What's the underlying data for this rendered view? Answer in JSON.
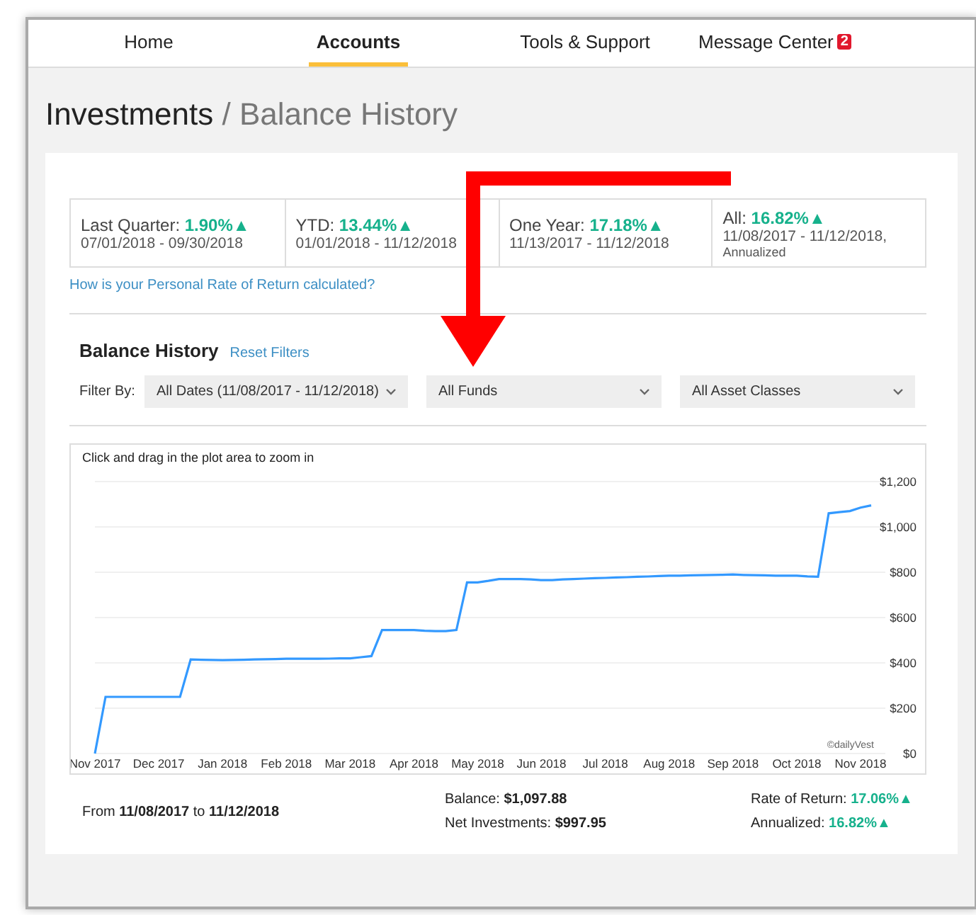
{
  "nav": {
    "tabs": [
      {
        "label": "Home",
        "selected": false
      },
      {
        "label": "Accounts",
        "selected": true
      },
      {
        "label": "Tools & Support",
        "selected": false
      },
      {
        "label": "Message Center",
        "selected": false,
        "badge": "2"
      }
    ]
  },
  "page_title": {
    "section": "Investments",
    "separator": "/",
    "current": "Balance History"
  },
  "returns": [
    {
      "label": "Last Quarter:",
      "value": "1.90%▲",
      "dates": "07/01/2018 - 09/30/2018"
    },
    {
      "label": "YTD:",
      "value": "13.44%▲",
      "dates": "01/01/2018 - 11/12/2018"
    },
    {
      "label": "One Year:",
      "value": "17.18%▲",
      "dates": "11/13/2017 - 11/12/2018"
    },
    {
      "label": "All:",
      "value": "16.82%▲",
      "dates": "11/08/2017 - 11/12/2018,",
      "note": "Annualized"
    }
  ],
  "help_link": "How is your Personal Rate of Return calculated?",
  "balance_history": {
    "heading": "Balance History",
    "reset_link": "Reset Filters",
    "filter_label": "Filter By:",
    "filters": [
      "All Dates (11/08/2017 - 11/12/2018)",
      "All Funds",
      "All Asset Classes"
    ]
  },
  "chart": {
    "hint": "Click and drag in the plot area to zoom in",
    "credit": "©dailyVest",
    "chart_data": {
      "type": "line",
      "grid": true,
      "ylim": [
        0,
        1200
      ],
      "categories": [
        "Nov 2017",
        null,
        null,
        null,
        null,
        null,
        "Dec 2017",
        null,
        null,
        null,
        null,
        null,
        "Jan 2018",
        null,
        null,
        null,
        null,
        null,
        "Feb 2018",
        null,
        null,
        null,
        null,
        null,
        "Mar 2018",
        null,
        null,
        null,
        null,
        null,
        "Apr 2018",
        null,
        null,
        null,
        null,
        null,
        "May 2018",
        null,
        null,
        null,
        null,
        null,
        "Jun 2018",
        null,
        null,
        null,
        null,
        null,
        "Jul 2018",
        null,
        null,
        null,
        null,
        null,
        "Aug 2018",
        null,
        null,
        null,
        null,
        null,
        "Sep 2018",
        null,
        null,
        null,
        null,
        null,
        "Oct 2018",
        null,
        null,
        null,
        null,
        null,
        "Nov 2018",
        null
      ],
      "series": [
        {
          "color": "#3399ff",
          "values": [
            0,
            250,
            250,
            250,
            250,
            250,
            250,
            250,
            250,
            415,
            414,
            413,
            412,
            413,
            414,
            415,
            416,
            417,
            418,
            418,
            418,
            418,
            419,
            420,
            420,
            425,
            430,
            545,
            545,
            545,
            545,
            542,
            540,
            540,
            545,
            755,
            755,
            762,
            770,
            770,
            770,
            768,
            765,
            765,
            768,
            770,
            772,
            774,
            775,
            777,
            778,
            780,
            781,
            783,
            785,
            785,
            786,
            787,
            788,
            789,
            790,
            788,
            787,
            786,
            785,
            785,
            785,
            782,
            780,
            1060,
            1065,
            1070,
            1085,
            1095
          ]
        }
      ],
      "yticks": [
        {
          "value": 0,
          "label": "$0"
        },
        {
          "value": 200,
          "label": "$200"
        },
        {
          "value": 400,
          "label": "$400"
        },
        {
          "value": 600,
          "label": "$600"
        },
        {
          "value": 800,
          "label": "$800"
        },
        {
          "value": 1000,
          "label": "$1,000"
        },
        {
          "value": 1200,
          "label": "$1,200"
        }
      ]
    }
  },
  "summary": {
    "period": "From **11/08/2017** to **11/12/2018**",
    "balance": {
      "label": "Balance:",
      "value": "$1,097.88"
    },
    "net_investments": {
      "label": "Net Investments:",
      "value": "$997.95"
    },
    "rate_of_return": {
      "label": "Rate of Return:",
      "value": "17.06%▲"
    },
    "annualized": {
      "label": "Annualized:",
      "value": "16.82%▲"
    }
  }
}
